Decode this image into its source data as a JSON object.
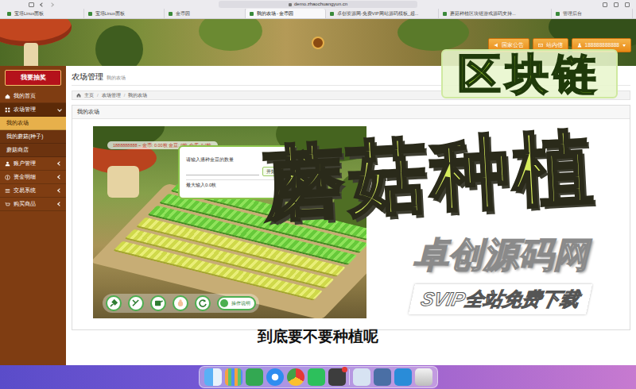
{
  "browser": {
    "url": "demo.zhaochuangyun.cn",
    "tabs": [
      {
        "label": "宝塔Linux面板",
        "selected": false
      },
      {
        "label": "宝塔Linux面板",
        "selected": false
      },
      {
        "label": "金币园",
        "selected": false
      },
      {
        "label": "我的农场 - 金币园",
        "selected": true
      },
      {
        "label": "卓创资源网-免费VIP网站源码模板_超...",
        "selected": false
      },
      {
        "label": "蘑菇种植区块链游戏源码支持...",
        "selected": false
      },
      {
        "label": "管理后台",
        "selected": false
      }
    ]
  },
  "header": {
    "buttons": [
      {
        "label": "国家公告",
        "kind": "button"
      },
      {
        "label": "站内信",
        "kind": "button"
      },
      {
        "label": "188888888888",
        "kind": "dropdown"
      }
    ]
  },
  "sidebar": {
    "lottery": "我要抽奖",
    "items": [
      {
        "label": "我的首页",
        "kind": "link",
        "selected": false
      },
      {
        "label": "农场管理",
        "kind": "group",
        "expanded": true,
        "selected": false
      },
      {
        "label": "我的农场",
        "kind": "child",
        "selected": true
      },
      {
        "label": "我的蘑菇(种子)",
        "kind": "child",
        "selected": false
      },
      {
        "label": "蘑菇商店",
        "kind": "child",
        "selected": false
      },
      {
        "label": "账户管理",
        "kind": "group",
        "expanded": false,
        "selected": false
      },
      {
        "label": "资金明细",
        "kind": "group",
        "expanded": false,
        "selected": false
      },
      {
        "label": "交易系统",
        "kind": "group",
        "expanded": false,
        "selected": false
      },
      {
        "label": "购买商品",
        "kind": "group",
        "expanded": false,
        "selected": false
      }
    ]
  },
  "page": {
    "title": "农场管理",
    "subtitle": "我的农场",
    "separator": "/",
    "breadcrumb": [
      {
        "label": "主页"
      },
      {
        "label": "农场管理"
      },
      {
        "label": "我的农场"
      }
    ],
    "panel_title": "我的农场"
  },
  "game": {
    "status": "1888888888 ~ 金币: 0.00枚 金豆: 0枚 仓库: 0.0枚",
    "dialog": {
      "prompt": "请输入播种金豆的数量",
      "button": "开始播种",
      "hint": "最大输入0.0枚"
    },
    "help": "操作说明"
  },
  "overlay": {
    "tag": "区块链",
    "title": "蘑菇种植",
    "brand": "卓创源码网",
    "slogan": "SVIP全站免费下载",
    "subtitle": "到底要不要种植呢"
  }
}
